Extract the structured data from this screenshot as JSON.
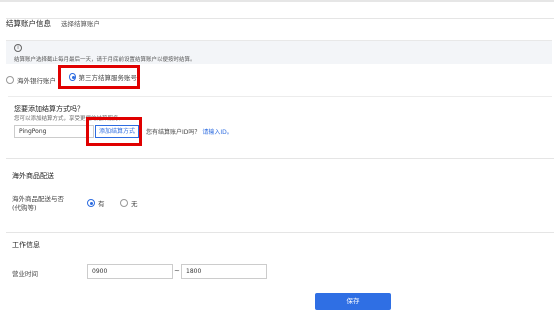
{
  "header": {
    "title": "结算账户信息",
    "subtitle": "选择结算账户"
  },
  "notice": {
    "text": "结算账户选择截止每月最后一天，请于月底前设置结算账户以便按时结算。"
  },
  "account_options": [
    {
      "label": "海外银行账户",
      "selected": false
    },
    {
      "label": "第三方结算服务账号",
      "selected": true
    }
  ],
  "add_method": {
    "title": "您要添加结算方式吗？",
    "desc": "您可以添加结算方式，享受更便的结算服务。",
    "provider_value": "PingPong",
    "add_button": "添加结算方式",
    "have_id_text": "您有结算账户ID吗？",
    "enter_id_link": "请输入ID。"
  },
  "shipping": {
    "section_title": "海外商品配送",
    "label_line1": "海外商品配送与否",
    "label_line2": "(代购等)",
    "yes": "有",
    "no": "无",
    "selected": "yes"
  },
  "work": {
    "section_title": "工作信息",
    "hours_label": "营业时间",
    "start": "0900",
    "separator": "~",
    "end": "1800"
  },
  "actions": {
    "save": "保存"
  },
  "colors": {
    "accent": "#2d6ce0",
    "highlight": "#e00000"
  },
  "icons": {
    "info": "info-icon",
    "dropdown": "chevron-down-icon"
  }
}
